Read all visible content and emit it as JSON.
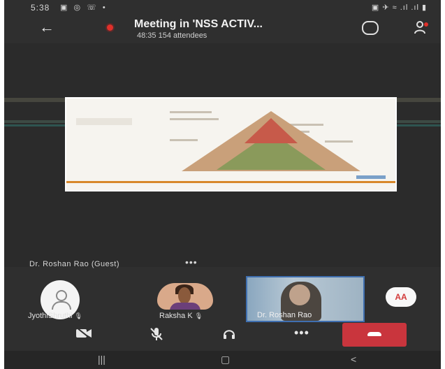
{
  "status_bar": {
    "time": "5:38",
    "left_icons": "▣ ◎ ☏ •",
    "right_icons": "▣ ✈ ≈ .ıl .ıl ▮"
  },
  "header": {
    "back_icon": "←",
    "title": "Meeting in 'NSS ACTIV...",
    "subtitle": "48:35   154 attendees",
    "chat_icon": "chat-bubble-icon",
    "participants_icon": "people-icon"
  },
  "presenter": {
    "name": "Dr. Roshan Rao (Guest)",
    "more": "•••"
  },
  "participants": [
    {
      "label": "JyothiShruthi",
      "mic": "🎙",
      "avatar": "person-silhouette"
    },
    {
      "label": "Raksha K",
      "mic": "🎙",
      "avatar": "photo"
    },
    {
      "label": "Dr. Roshan Rao",
      "avatar": "video"
    }
  ],
  "badge": {
    "initials": "AA",
    "color": "#d23a3a"
  },
  "controls": {
    "camera_off": "camera-off-icon",
    "mic_off": "mic-off-icon",
    "audio": "headset-icon",
    "more": "•••",
    "leave": "hang-up-icon",
    "leave_color": "#c9353d"
  },
  "nav": {
    "recent": "|||",
    "home": "▢",
    "back": "<"
  }
}
